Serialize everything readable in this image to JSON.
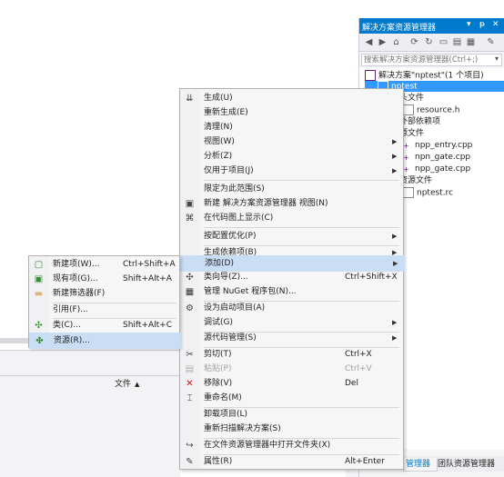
{
  "background": {
    "file_column_header": "文件",
    "sort_glyph": "▲"
  },
  "solution_explorer": {
    "title": "解决方案资源管理器",
    "title_buttons": [
      "▾",
      "ᵽ",
      "✕"
    ],
    "search_placeholder": "搜索解决方案资源管理器(Ctrl+;)",
    "tree": {
      "solution": "解决方案\"nptest\"(1 个项目)",
      "project": "nptest",
      "header_files": "头文件",
      "resource_h": "resource.h",
      "external_deps": "外部依赖项",
      "source_files": "源文件",
      "npp_entry": "npp_entry.cpp",
      "npn_gate": "npn_gate.cpp",
      "npp_gate": "npp_gate.cpp",
      "resource_files": "资源文件",
      "nptest_rc": "nptest.rc"
    },
    "tabs": {
      "active": "管理器",
      "team": "团队资源管理器"
    }
  },
  "context_menu": {
    "build": "生成(U)",
    "rebuild": "重新生成(E)",
    "clean": "清理(N)",
    "view": "视图(W)",
    "analyze": "分析(Z)",
    "project_only": "仅用于项目(J)",
    "scope_to_this": "限定为此范围(S)",
    "new_se_view": "新建 解决方案资源管理器 视图(N)",
    "show_on_code_map": "在代码图上显示(C)",
    "pgo": "按配置优化(P)",
    "build_deps": "生成依赖项(B)",
    "add": "添加(D)",
    "class_wizard": "类向导(Z)...",
    "class_wizard_shortcut": "Ctrl+Shift+X",
    "nuget": "管理 NuGet 程序包(N)...",
    "set_startup": "设为启动项目(A)",
    "debug": "调试(G)",
    "source_control": "源代码管理(S)",
    "cut": "剪切(T)",
    "cut_shortcut": "Ctrl+X",
    "paste": "粘贴(P)",
    "paste_shortcut": "Ctrl+V",
    "remove": "移除(V)",
    "remove_shortcut": "Del",
    "rename": "重命名(M)",
    "unload": "卸载项目(L)",
    "rescan": "重新扫描解决方案(S)",
    "open_in_explorer": "在文件资源管理器中打开文件夹(X)",
    "properties": "属性(R)",
    "properties_shortcut": "Alt+Enter"
  },
  "add_submenu": {
    "new_item": "新建项(W)...",
    "new_item_shortcut": "Ctrl+Shift+A",
    "existing_item": "现有项(G)...",
    "existing_item_shortcut": "Shift+Alt+A",
    "new_filter": "新建筛选器(F)",
    "reference": "引用(F)...",
    "class": "类(C)...",
    "class_shortcut": "Shift+Alt+C",
    "resource": "资源(R)..."
  },
  "colors": {
    "accent": "#007acc",
    "selection": "#3399ff",
    "menu_highlight": "#c9def5",
    "remove_red": "#d11010"
  }
}
